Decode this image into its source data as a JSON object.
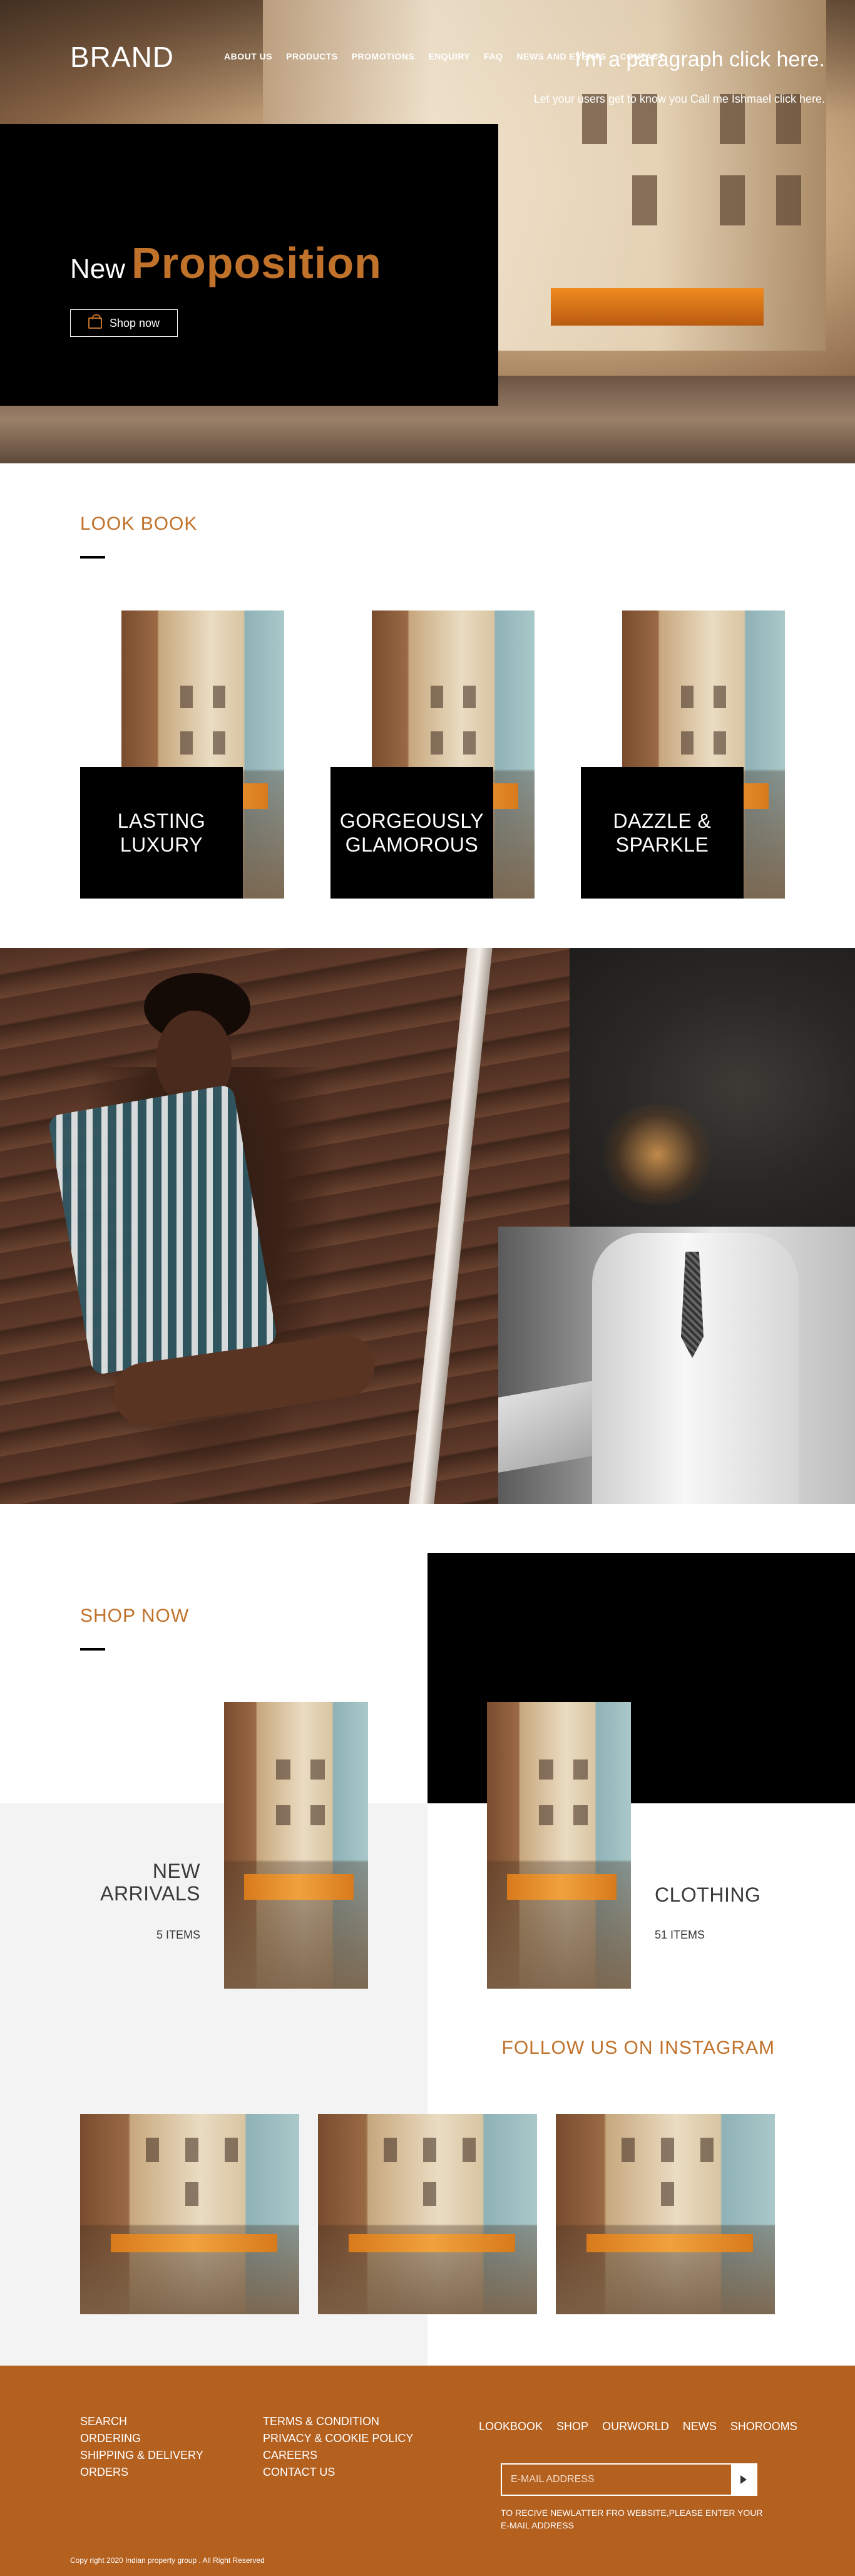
{
  "header": {
    "brand": "BRAND",
    "nav": [
      "ABOUT US",
      "PRODUCTS",
      "PROMOTIONS",
      "ENQUIRY",
      "FAQ",
      "NEWS AND EVENTS",
      "CONTACT"
    ]
  },
  "hero": {
    "title_plain": "New",
    "title_accent": "Proposition",
    "button_label": "Shop now",
    "button_icon": "shopping-bag-icon"
  },
  "lookbook": {
    "heading": "LOOK BOOK",
    "cards": [
      {
        "line1": "LASTING",
        "line2": "LUXURY"
      },
      {
        "line1": "GORGEOUSLY",
        "line2": "GLAMOROUS"
      },
      {
        "line1": "DAZZLE &",
        "line2": "SPARKLE"
      }
    ]
  },
  "feature": {
    "title": "I'm a paragraph click here.",
    "text": "Let your users get to know you Call me Ishmael click here."
  },
  "shop": {
    "heading": "SHOP NOW",
    "categories": [
      {
        "name_line1": "NEW",
        "name_line2": "ARRIVALS",
        "count": "5 ITEMS"
      },
      {
        "name_line1": "CLOTHING",
        "name_line2": "",
        "count": "51 ITEMS"
      }
    ]
  },
  "instagram": {
    "heading": "FOLLOW US ON INSTAGRAM"
  },
  "footer": {
    "col1": [
      "SEARCH",
      "ORDERING",
      "SHIPPING & DELIVERY",
      "ORDERS"
    ],
    "col2": [
      "TERMS & CONDITION",
      "PRIVACY & COOKIE POLICY",
      "CAREERS",
      "CONTACT US"
    ],
    "links": [
      "LOOKBOOK",
      "SHOP",
      "OURWORLD",
      "NEWS",
      "SHOROOMS"
    ],
    "email_placeholder": "E-MAIL ADDRESS",
    "submit_icon": "arrow-right-icon",
    "newsletter_note": "TO RECIVE NEWLATTER FRO WEBSITE,PLEASE ENTER YOUR E-MAIL ADDRESS",
    "copyright": "Copy right 2020 Indian property group . All Right Reserved"
  },
  "colors": {
    "accent": "#c0712a",
    "footer_bg": "#b4601f",
    "black": "#000000",
    "grey_bg": "#f3f3f3"
  }
}
